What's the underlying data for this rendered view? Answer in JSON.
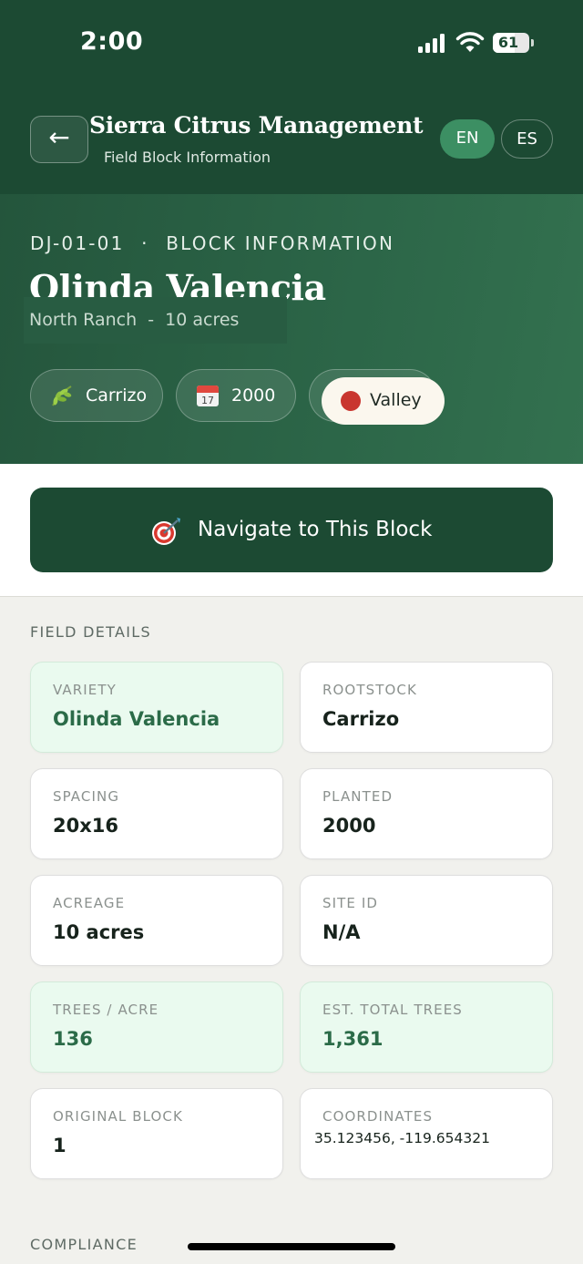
{
  "status_bar": {
    "time": "2:00",
    "battery": "61",
    "battery_level": 0.61
  },
  "header": {
    "back_icon": "left-arrow-icon",
    "title": "Sierra Citrus Management",
    "subtitle": "Field Block Information",
    "languages": [
      "EN",
      "ES"
    ],
    "active_language": "EN"
  },
  "hero": {
    "block_id": "DJ-01-01",
    "separator": "·",
    "section": "BLOCK INFORMATION",
    "title": "Olinda Valencia",
    "subtitle": "North Ranch  -  10 acres",
    "chips": {
      "rootstock": {
        "label": "Carrizo",
        "icon": "leaf-icon"
      },
      "year": {
        "label": "2000",
        "icon": "calendar-icon"
      },
      "region": {
        "label": "Valley",
        "icon": "red-dot-icon",
        "color": "#c9362f"
      }
    }
  },
  "navigate_button": {
    "label": "Navigate to This Block",
    "icon": "target-icon"
  },
  "field_details": {
    "heading": "FIELD DETAILS",
    "cards": [
      {
        "key": "VARIETY",
        "value": "Olinda Valencia",
        "highlight": true
      },
      {
        "key": "ROOTSTOCK",
        "value": "Carrizo",
        "highlight": false
      },
      {
        "key": "SPACING",
        "value": "20x16",
        "highlight": false
      },
      {
        "key": "PLANTED",
        "value": "2000",
        "highlight": false
      },
      {
        "key": "ACREAGE",
        "value": "10 acres",
        "highlight": false
      },
      {
        "key": "SITE ID",
        "value": "N/A",
        "highlight": false
      },
      {
        "key": "TREES / ACRE",
        "value": "136",
        "highlight": true
      },
      {
        "key": "EST. TOTAL TREES",
        "value": "1,361",
        "highlight": true
      },
      {
        "key": "ORIGINAL BLOCK",
        "value": "1",
        "highlight": false
      },
      {
        "key": "COORDINATES",
        "value": "35.123456, -119.654321",
        "highlight": false
      }
    ]
  },
  "compliance": {
    "heading": "COMPLIANCE"
  },
  "colors": {
    "primary": "#1c4a33",
    "accent": "#3c8f63",
    "highlight_bg": "#eafaef",
    "highlight_text": "#2b6b48"
  }
}
